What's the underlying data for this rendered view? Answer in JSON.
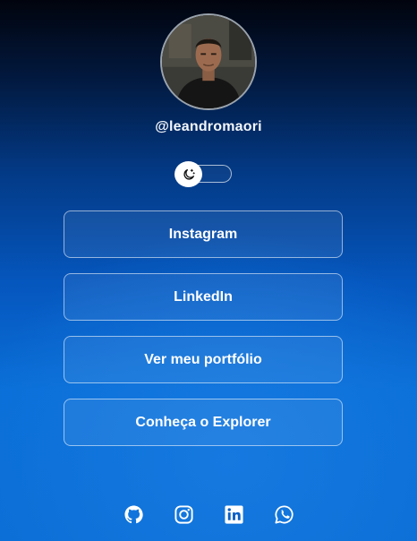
{
  "profile": {
    "handle": "@leandromaori"
  },
  "theme_toggle": {
    "icon": "moon-stars-icon",
    "state": "dark"
  },
  "links": [
    {
      "label": "Instagram"
    },
    {
      "label": "LinkedIn"
    },
    {
      "label": "Ver meu portfólio"
    },
    {
      "label": "Conheça o Explorer"
    }
  ],
  "socials": [
    {
      "icon": "github-icon"
    },
    {
      "icon": "instagram-icon"
    },
    {
      "icon": "linkedin-icon"
    },
    {
      "icon": "whatsapp-icon"
    }
  ],
  "colors": {
    "background_top": "#01040d",
    "background_bottom": "#0b6ed6",
    "text": "#ffffff",
    "button_border": "#ffffff"
  }
}
